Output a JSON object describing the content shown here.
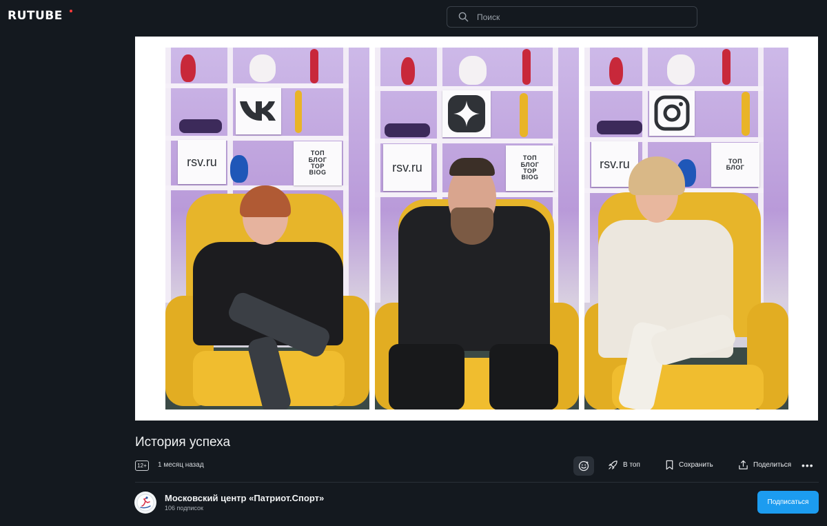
{
  "header": {
    "logo": "RUTUBE",
    "search_placeholder": "Поиск"
  },
  "video": {
    "frames": [
      {
        "name": "vk",
        "site": "rsv.ru",
        "sign": [
          "ТОП",
          "БЛОГ",
          "TOP",
          "BlOG"
        ]
      },
      {
        "name": "zen",
        "site": "rsv.ru",
        "sign": [
          "ТОП",
          "БЛОГ",
          "TOP",
          "BlOG"
        ]
      },
      {
        "name": "instagram",
        "site": "rsv.ru",
        "sign": [
          "ТОП",
          "БЛОГ"
        ]
      }
    ]
  },
  "info": {
    "title": "История успеха",
    "age_rating": "12+",
    "published": "1 месяц назад",
    "actions": {
      "top": "В топ",
      "save": "Сохранить",
      "share": "Поделиться"
    }
  },
  "channel": {
    "name": "Московский центр «Патриот.Спорт»",
    "subscribers": "106 подписок",
    "subscribe_label": "Подписаться"
  },
  "colors": {
    "background": "#14191f",
    "accent": "#1c9cf0",
    "logo_dot": "#ff3b3b"
  }
}
